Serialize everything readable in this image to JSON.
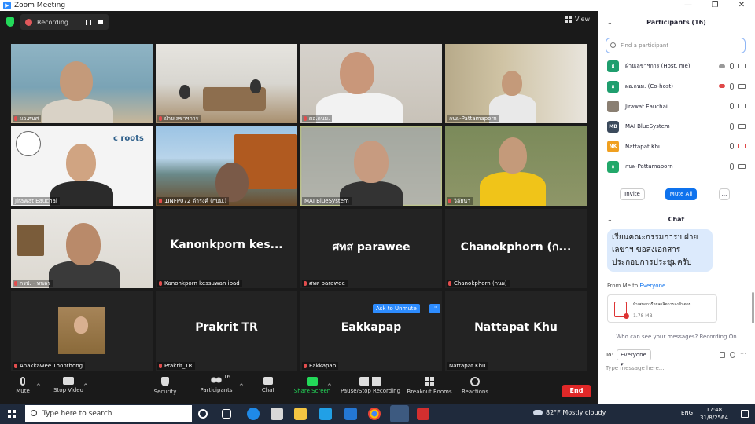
{
  "window": {
    "title": "Zoom Meeting"
  },
  "recording": {
    "label": "Recording..."
  },
  "view_label": "View",
  "tiles": [
    {
      "name": "ผอ.ศนศ",
      "big": ""
    },
    {
      "name": "ฝ่ายเลขาฯการ",
      "big": ""
    },
    {
      "name": "ผอ.กนม.",
      "big": ""
    },
    {
      "name": "กนผ-Pattamaporn",
      "big": ""
    },
    {
      "name": "Jirawat Eauchai",
      "big": ""
    },
    {
      "name": "1INFP072 ดำรงค์ (กปม.)",
      "big": ""
    },
    {
      "name": "MAI BlueSystem",
      "big": ""
    },
    {
      "name": "วิลัยนา",
      "big": ""
    },
    {
      "name": "กรป. - ทนลร",
      "big": ""
    },
    {
      "name": "Kanonkporn kessuwan ipad",
      "big": "Kanonkporn  kes..."
    },
    {
      "name": "ศทส parawee",
      "big": "ศทส parawee"
    },
    {
      "name": "Chanokphorn (กนผ)",
      "big": "Chanokphorn  (ก..."
    },
    {
      "name": "Anakkawee Thonthong",
      "big": ""
    },
    {
      "name": "Prakrit_TR",
      "big": "Prakrit  TR"
    },
    {
      "name": "Eakkapap",
      "big": "Eakkapap"
    },
    {
      "name": "Nattapat Khu",
      "big": "Nattapat Khu"
    }
  ],
  "ask_to_unmute": "Ask to Unmute",
  "more_dots": "···",
  "toolbar": {
    "mute": "Mute",
    "stop_video": "Stop Video",
    "security": "Security",
    "participants": "Participants",
    "participants_count": "16",
    "chat": "Chat",
    "share_screen": "Share Screen",
    "pause_recording": "Pause/Stop Recording",
    "breakout": "Breakout Rooms",
    "reactions": "Reactions",
    "end": "End"
  },
  "participants_panel": {
    "title": "Participants (16)",
    "search_placeholder": "Find a participant",
    "items": [
      {
        "avatar": "ฝ",
        "color": "#1f9e6e",
        "name": "ฝ่ายเลขาฯการ (Host, me)"
      },
      {
        "avatar": "ผ",
        "color": "#1f9e6e",
        "name": "ผอ.กนม. (Co-host)"
      },
      {
        "avatar": "",
        "color": "#8a7f72",
        "name": "Jirawat Eauchai"
      },
      {
        "avatar": "MB",
        "color": "#3b4a5c",
        "name": "MAI BlueSystem"
      },
      {
        "avatar": "NK",
        "color": "#f0a020",
        "name": "Nattapat Khu"
      },
      {
        "avatar": "ก",
        "color": "#22a86a",
        "name": "กนผ-Pattamaporn"
      }
    ],
    "invite": "Invite",
    "mute_all": "Mute All",
    "more": "..."
  },
  "chat_panel": {
    "title": "Chat",
    "message": "เรียนคณะกรรมการฯ ฝ่ายเลขาฯ ขอส่งเอกสารประกอบการประชุมครับ",
    "from_prefix": "From Me to ",
    "from_target": "Everyone",
    "file_name": "ผ้าเสนอการือผลผลิตการลงขั้นตอน...",
    "file_size": "1.78 MB",
    "who_can_see": "Who can see your messages? Recording On",
    "to_label": "To:",
    "to_value": "Everyone",
    "placeholder": "Type message here..."
  },
  "taskbar": {
    "search_placeholder": "Type here to search",
    "weather": "82°F  Mostly cloudy",
    "lang": "ENG",
    "time": "17:48",
    "date": "31/8/2564"
  }
}
